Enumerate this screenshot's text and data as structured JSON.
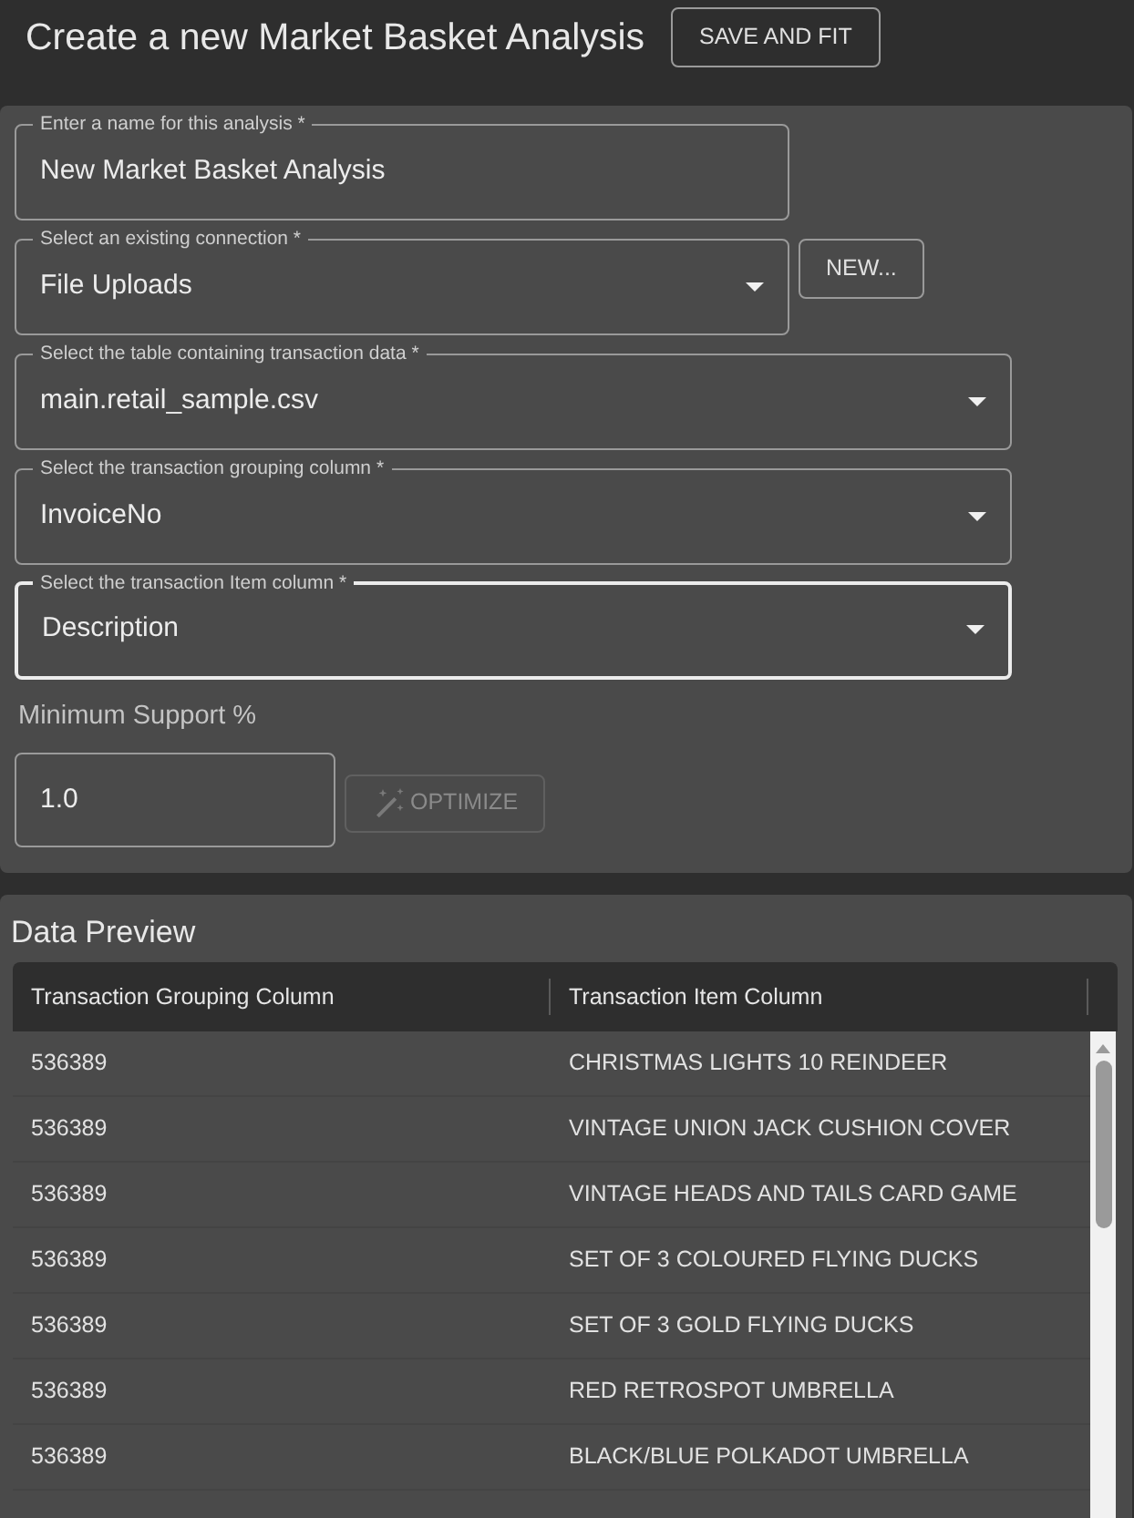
{
  "header": {
    "title": "Create a new Market Basket Analysis",
    "button": {
      "label": "SAVE AND FIT"
    }
  },
  "form": {
    "fields": [
      {
        "kind": "text",
        "label": "Enter a name for this analysis *",
        "value": "New Market Basket Analysis",
        "focused": false
      },
      {
        "kind": "select",
        "label": "Select an existing connection *",
        "value": "File Uploads",
        "focused": false,
        "button": {
          "label": "NEW..."
        }
      },
      {
        "kind": "select",
        "label": "Select the table containing transaction data *",
        "value": "main.retail_sample.csv",
        "focused": false
      },
      {
        "kind": "select",
        "label": "Select the transaction grouping column *",
        "value": "InvoiceNo",
        "focused": false
      },
      {
        "kind": "select",
        "label": "Select the transaction Item column *",
        "value": "Description",
        "focused": true
      }
    ],
    "support": {
      "label": "Minimum Support %",
      "value": "1.0",
      "button": {
        "label": "OPTIMIZE",
        "disabled": true
      }
    }
  },
  "preview": {
    "title": "Data Preview",
    "columns": [
      "Transaction Grouping Column",
      "Transaction Item Column"
    ],
    "rows": [
      [
        "536389",
        "CHRISTMAS LIGHTS 10 REINDEER"
      ],
      [
        "536389",
        "VINTAGE UNION JACK CUSHION COVER"
      ],
      [
        "536389",
        "VINTAGE HEADS AND TAILS CARD GAME"
      ],
      [
        "536389",
        "SET OF 3 COLOURED FLYING DUCKS"
      ],
      [
        "536389",
        "SET OF 3 GOLD FLYING DUCKS"
      ],
      [
        "536389",
        "RED RETROSPOT UMBRELLA"
      ],
      [
        "536389",
        "BLACK/BLUE POLKADOT UMBRELLA"
      ]
    ]
  }
}
